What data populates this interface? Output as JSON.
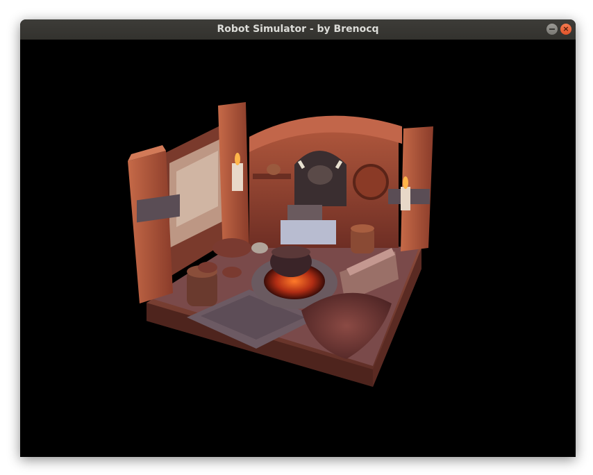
{
  "window": {
    "title": "Robot Simulator - by Brenocq",
    "minimize_icon": "minimize-icon",
    "close_icon": "close-icon",
    "close_glyph": "×"
  },
  "viewport": {
    "background": "#000000"
  }
}
